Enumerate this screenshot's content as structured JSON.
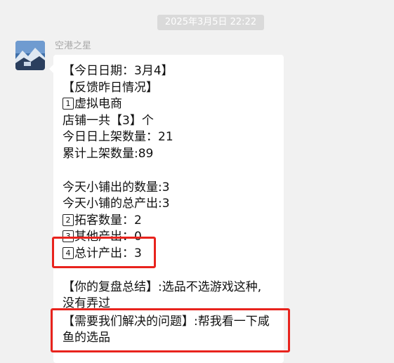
{
  "timestamp": "2025年3月5日 22:22",
  "sender": {
    "name": "空港之星"
  },
  "message": {
    "lines": {
      "l1": "【今日日期：3月4】",
      "l2": "【反馈昨日情况】",
      "l3_num": "1",
      "l3": "虚拟电商",
      "l4": "店铺一共【3】个",
      "l5": "今日日上架数量：21",
      "l6": "累计上架数量:89",
      "l7": "今天小铺出的数量:3",
      "l8": "今天小铺的总产出:3",
      "l9_num": "2",
      "l9": "拓客数量：2",
      "l10_num": "3",
      "l10": "其他产出：0",
      "l11_num": "4",
      "l11": "总计产出：3",
      "l12": "【你的复盘总结】:选品不选游戏这种,",
      "l13": "没有弄过",
      "l14": "【需要我们解决的问题】:帮我看一下咸",
      "l15": "鱼的选品"
    }
  },
  "colors": {
    "highlight": "#e8231d",
    "chat_background": "#f1f1f1",
    "bubble": "#ffffff"
  }
}
